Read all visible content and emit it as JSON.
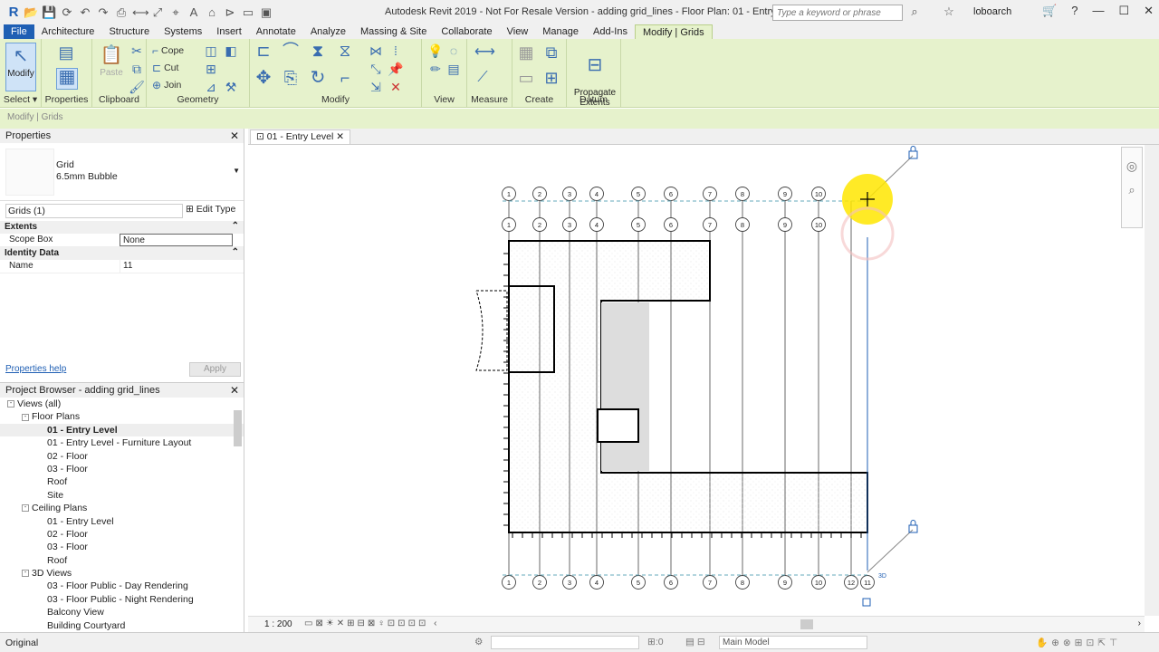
{
  "app": {
    "logo": "R",
    "title": "Autodesk Revit 2019 - Not For Resale Version - adding grid_lines - Floor Plan: 01 - Entry Level",
    "search_placeholder": "Type a keyword or phrase",
    "user": "loboarch"
  },
  "tabs": [
    "File",
    "Architecture",
    "Structure",
    "Systems",
    "Insert",
    "Annotate",
    "Analyze",
    "Massing & Site",
    "Collaborate",
    "View",
    "Manage",
    "Add-Ins",
    "Modify | Grids"
  ],
  "ribbon": {
    "select_label": "Select ▾",
    "modify_btn": "Modify",
    "properties_label": "Properties",
    "clipboard_label": "Clipboard",
    "paste": "Paste",
    "cope": "Cope",
    "cut": "Cut",
    "join": "Join",
    "geometry_label": "Geometry",
    "modify_label": "Modify",
    "view_label": "View",
    "measure_label": "Measure",
    "create_label": "Create",
    "propagate": "Propagate\nExtents",
    "datum_label": "Datum"
  },
  "context_bar": "Modify | Grids",
  "properties": {
    "header": "Properties",
    "type_line1": "Grid",
    "type_line2": "6.5mm Bubble",
    "instance": "Grids (1)",
    "edit_type": "Edit Type",
    "sections": [
      {
        "name": "Extents",
        "rows": [
          {
            "k": "Scope Box",
            "v": "None"
          }
        ]
      },
      {
        "name": "Identity Data",
        "rows": [
          {
            "k": "Name",
            "v": "11"
          }
        ]
      }
    ],
    "help": "Properties help",
    "apply": "Apply"
  },
  "browser": {
    "header": "Project Browser - adding grid_lines",
    "items": [
      {
        "t": "Views (all)",
        "lvl": 0,
        "tog": "-"
      },
      {
        "t": "Floor Plans",
        "lvl": 1,
        "tog": "-"
      },
      {
        "t": "01 - Entry Level",
        "lvl": 2,
        "bold": true
      },
      {
        "t": "01 - Entry Level - Furniture Layout",
        "lvl": 2
      },
      {
        "t": "02 - Floor",
        "lvl": 2
      },
      {
        "t": "03 - Floor",
        "lvl": 2
      },
      {
        "t": "Roof",
        "lvl": 2
      },
      {
        "t": "Site",
        "lvl": 2
      },
      {
        "t": "Ceiling Plans",
        "lvl": 1,
        "tog": "-"
      },
      {
        "t": "01 - Entry Level",
        "lvl": 2
      },
      {
        "t": "02 - Floor",
        "lvl": 2
      },
      {
        "t": "03 - Floor",
        "lvl": 2
      },
      {
        "t": "Roof",
        "lvl": 2
      },
      {
        "t": "3D Views",
        "lvl": 1,
        "tog": "-"
      },
      {
        "t": "03 - Floor Public - Day Rendering",
        "lvl": 2
      },
      {
        "t": "03 - Floor Public - Night Rendering",
        "lvl": 2
      },
      {
        "t": "Balcony View",
        "lvl": 2
      },
      {
        "t": "Building Courtyard",
        "lvl": 2
      }
    ]
  },
  "view_tab": "01 - Entry Level",
  "canvas": {
    "grid_top1": [
      "1",
      "2",
      "3",
      "4",
      "5",
      "6",
      "7",
      "8",
      "9",
      "10"
    ],
    "grid_top2": [
      "1",
      "2",
      "3",
      "4",
      "5",
      "6",
      "7",
      "8",
      "9",
      "10"
    ],
    "grid_bottom": [
      "1",
      "2",
      "3",
      "4",
      "5",
      "6",
      "7",
      "8",
      "9",
      "10",
      "12",
      "11"
    ],
    "dim_label": "3D"
  },
  "view_bar": {
    "scale": "1 : 200"
  },
  "status": {
    "text": "Original",
    "model": "Main Model",
    "zero": ":0"
  }
}
